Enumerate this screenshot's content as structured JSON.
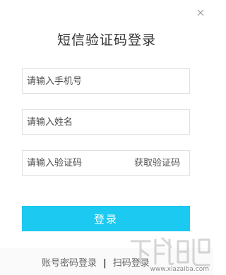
{
  "dialog": {
    "title": "短信验证码登录",
    "close_icon": "close-icon"
  },
  "form": {
    "phone_placeholder": "请输入手机号",
    "name_placeholder": "请输入姓名",
    "code_placeholder": "请输入验证码",
    "get_code_label": "获取验证码",
    "login_label": "登录"
  },
  "footer": {
    "password_login_label": "账号密码登录",
    "separator": "|",
    "qr_login_label": "扫码登录"
  },
  "watermark": {
    "url": "www.xiazaiba.com"
  },
  "colors": {
    "accent": "#1cc9f0",
    "border": "#e1e1e1",
    "footer_bg": "#fafafa"
  }
}
